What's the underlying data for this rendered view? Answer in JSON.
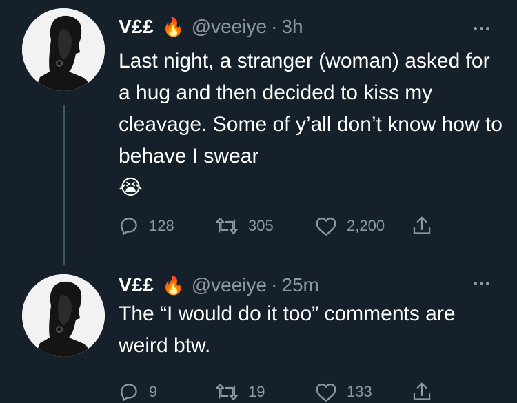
{
  "colors": {
    "background": "#15202b",
    "primary_text": "#ffffff",
    "secondary_text": "#8b98a5",
    "thread_line": "#3d5466"
  },
  "tweets": [
    {
      "name": "V££",
      "name_emoji": "🔥",
      "handle": "@veeiye",
      "separator": "·",
      "time": "3h",
      "text": "Last night, a stranger (woman) asked for a hug and then decided to kiss my cleavage. Some of y’all don’t know how to behave I swear",
      "text_emoji": "😭",
      "replies": "128",
      "retweets": "305",
      "likes": "2,200"
    },
    {
      "name": "V££",
      "name_emoji": "🔥",
      "handle": "@veeiye",
      "separator": "·",
      "time": "25m",
      "text": "The “I would do it too” comments are weird btw.",
      "replies": "9",
      "retweets": "19",
      "likes": "133"
    }
  ],
  "icons": {
    "more": "more-horizontal-icon",
    "reply": "reply-icon",
    "retweet": "retweet-icon",
    "like": "heart-icon",
    "share": "share-icon"
  }
}
